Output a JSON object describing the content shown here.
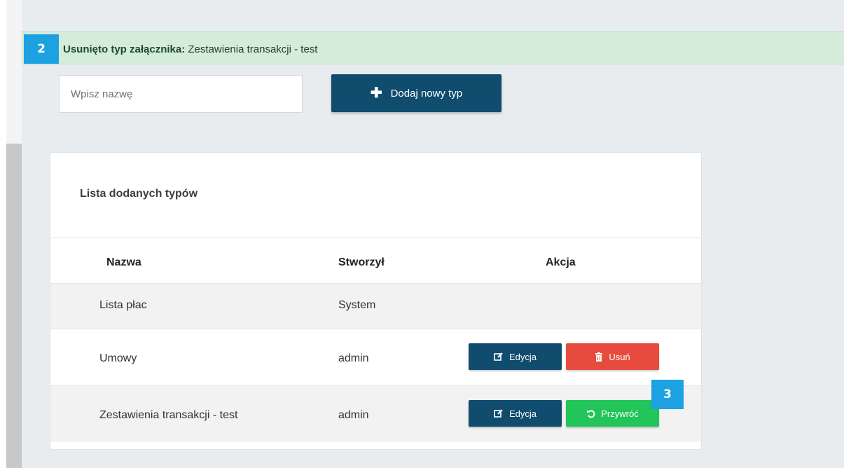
{
  "alert": {
    "marker": "2",
    "label": "Usunięto typ załącznika:",
    "item": "Zestawienia transakcji - test"
  },
  "form": {
    "name_placeholder": "Wpisz nazwę",
    "add_label": "Dodaj nowy typ"
  },
  "card": {
    "title": "Lista dodanych typów",
    "columns": {
      "name": "Nazwa",
      "creator": "Stworzył",
      "action": "Akcja"
    },
    "rows": [
      {
        "name": "Lista płac",
        "creator": "System"
      },
      {
        "name": "Umowy",
        "creator": "admin",
        "edit_label": "Edycja",
        "delete_label": "Usuń"
      },
      {
        "name": "Zestawienia transakcji - test",
        "creator": "admin",
        "edit_label": "Edycja",
        "restore_label": "Przywróć"
      }
    ]
  },
  "marker_3": "3",
  "icons": {
    "add": "plus-icon",
    "edit": "edit-icon",
    "delete": "trash-icon",
    "restore": "undo-icon"
  },
  "colors": {
    "primary": "#0f4c6e",
    "danger": "#e64b3e",
    "success": "#22c55a",
    "alert_bg": "#d4ecd9",
    "marker": "#1da1e0"
  }
}
